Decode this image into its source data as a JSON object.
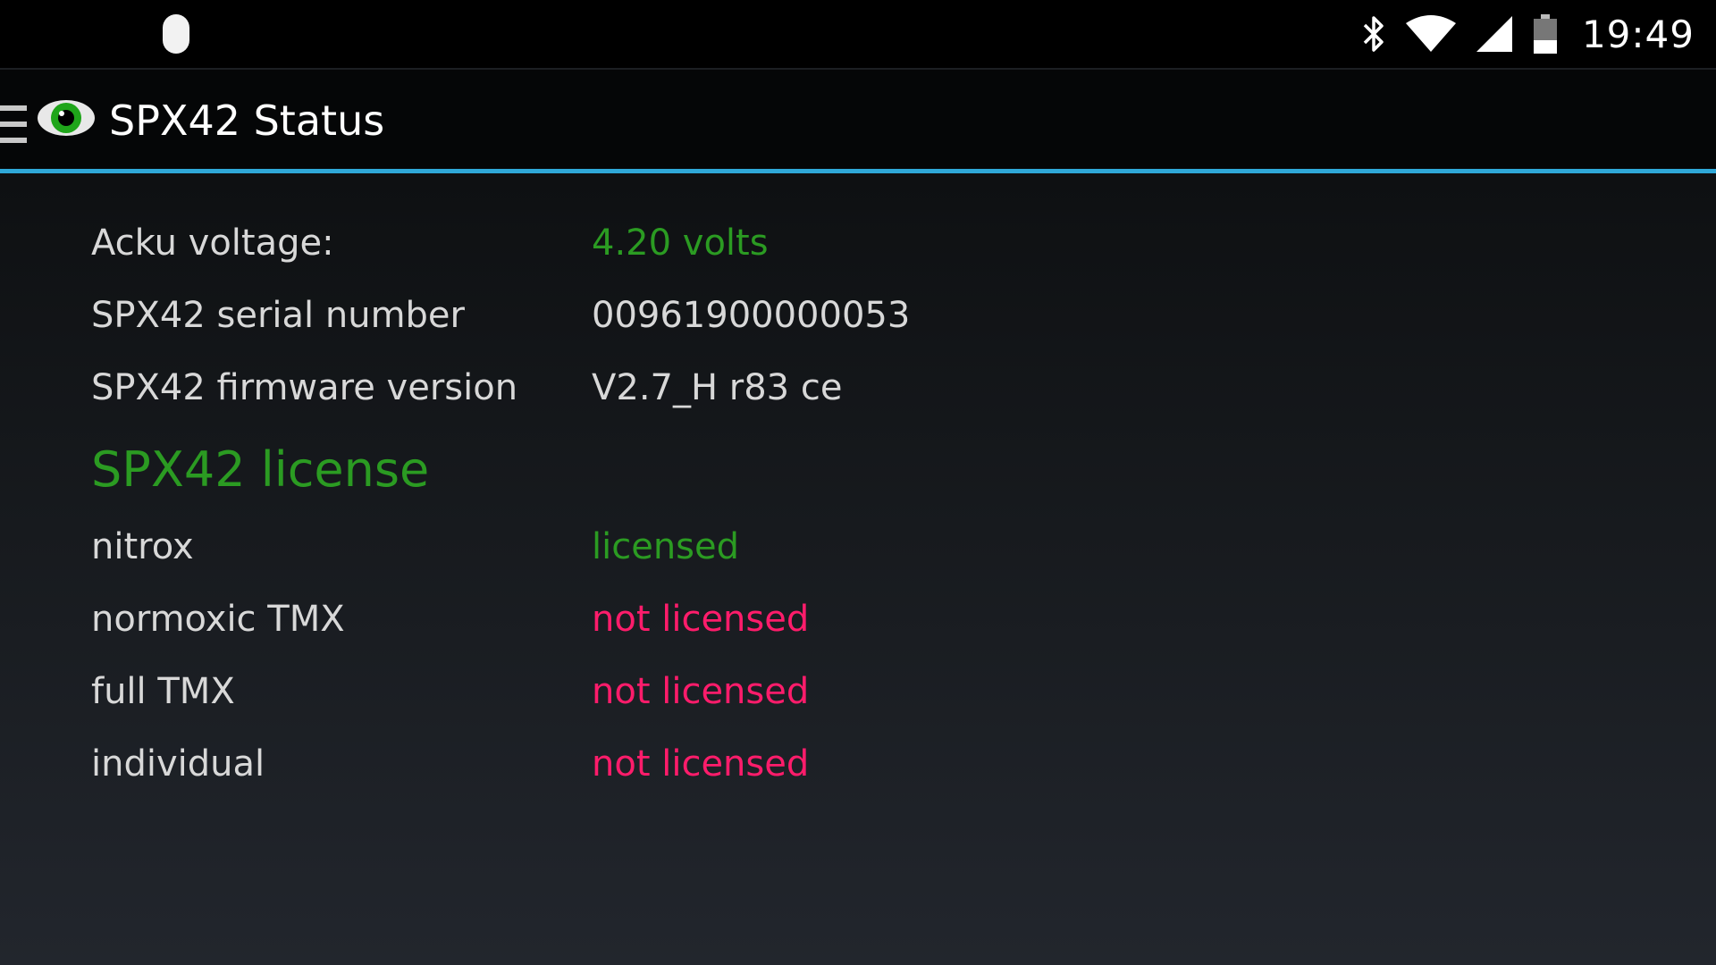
{
  "statusbar": {
    "time": "19:49",
    "icons": [
      "bluetooth-icon",
      "wifi-icon",
      "cell-signal-icon",
      "battery-icon"
    ]
  },
  "actionbar": {
    "title": "SPX42 Status",
    "icon": "eye-icon"
  },
  "info_rows": [
    {
      "label": "Acku voltage:",
      "value": "4.20 volts",
      "value_color": "#2b9b22"
    },
    {
      "label": "SPX42 serial number",
      "value": "00961900000053",
      "value_color": "#d8d8d8"
    },
    {
      "label": "SPX42 firmware version",
      "value": "V2.7_H r83 ce",
      "value_color": "#d8d8d8"
    }
  ],
  "license": {
    "title": "SPX42 license",
    "rows": [
      {
        "label": "nitrox",
        "value": "licensed",
        "value_color": "#2b9b22"
      },
      {
        "label": "normoxic TMX",
        "value": "not licensed",
        "value_color": "#ff1c6b"
      },
      {
        "label": "full TMX",
        "value": "not licensed",
        "value_color": "#ff1c6b"
      },
      {
        "label": "individual",
        "value": "not licensed",
        "value_color": "#ff1c6b"
      }
    ]
  },
  "colors": {
    "accent": "#2fa8d8",
    "ok": "#2b9b22",
    "error": "#ff1c6b"
  }
}
